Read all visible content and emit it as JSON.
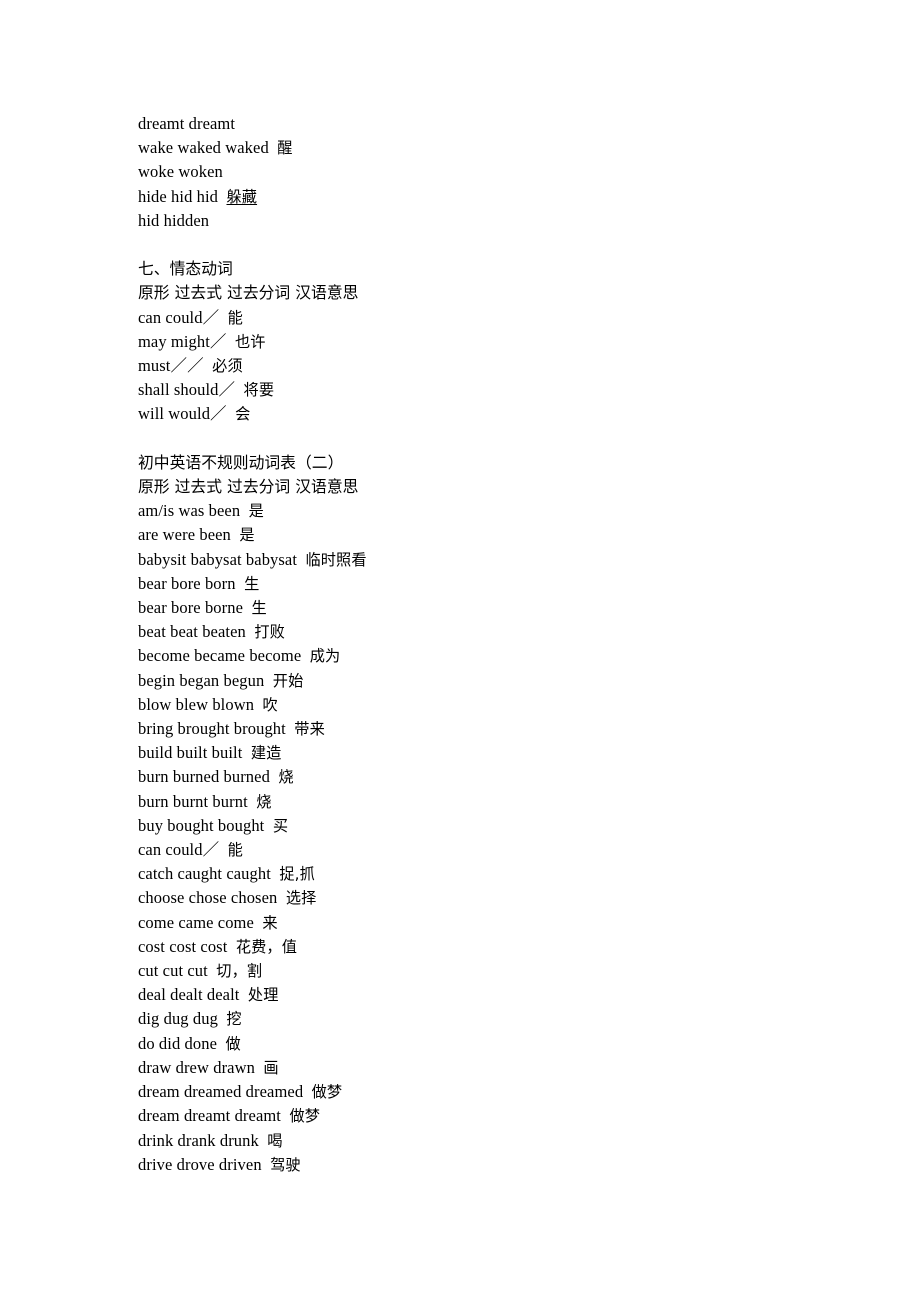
{
  "document": {
    "sections": [
      {
        "id": "continuation-lines",
        "heading": null,
        "column_header": null,
        "lines": [
          {
            "en": "dreamt dreamt",
            "zh": "",
            "zh_underlined": false
          },
          {
            "en": "wake waked waked",
            "zh": "醒",
            "zh_underlined": false
          },
          {
            "en": "woke woken",
            "zh": "",
            "zh_underlined": false
          },
          {
            "en": "hide hid hid",
            "zh": "躲藏",
            "zh_underlined": true
          },
          {
            "en": "hid hidden",
            "zh": "",
            "zh_underlined": false
          }
        ]
      },
      {
        "id": "modal-verbs",
        "heading": {
          "prefix": "七、",
          "title": "情态动词",
          "title_underlined": true,
          "suffix": ""
        },
        "column_header": "原形 过去式 过去分词 汉语意思",
        "lines": [
          {
            "en": "can could／",
            "zh": "能",
            "zh_underlined": false
          },
          {
            "en": "may might／",
            "zh": "也许",
            "zh_underlined": false
          },
          {
            "en": "must／／",
            "zh": "必须",
            "zh_underlined": false
          },
          {
            "en": "shall should／",
            "zh": "将要",
            "zh_underlined": false
          },
          {
            "en": "will would／",
            "zh": "会",
            "zh_underlined": false
          }
        ]
      },
      {
        "id": "irregular-verbs-table-2",
        "heading": {
          "prefix": "",
          "title": "初中英语不规则动词表",
          "title_underlined": true,
          "suffix": "（二）"
        },
        "column_header": "原形 过去式 过去分词 汉语意思",
        "lines": [
          {
            "en": "am/is was been",
            "zh": "是",
            "zh_underlined": false
          },
          {
            "en": "are were been",
            "zh": "是",
            "zh_underlined": false
          },
          {
            "en": "babysit babysat babysat",
            "zh": "临时照看",
            "zh_underlined": false
          },
          {
            "en": "bear bore born",
            "zh": "生",
            "zh_underlined": false
          },
          {
            "en": "bear bore borne",
            "zh": "生",
            "zh_underlined": false
          },
          {
            "en": "beat beat beaten",
            "zh": "打败",
            "zh_underlined": false
          },
          {
            "en": "become became become",
            "zh": "成为",
            "zh_underlined": false
          },
          {
            "en": "begin began begun",
            "zh": "开始",
            "zh_underlined": false
          },
          {
            "en": "blow blew blown",
            "zh": "吹",
            "zh_underlined": false
          },
          {
            "en": "bring brought brought",
            "zh": "带来",
            "zh_underlined": false
          },
          {
            "en": "build built built",
            "zh": "建造",
            "zh_underlined": false
          },
          {
            "en": "burn burned burned",
            "zh": "烧",
            "zh_underlined": false
          },
          {
            "en": "burn burnt burnt",
            "zh": "烧",
            "zh_underlined": false
          },
          {
            "en": "buy bought bought",
            "zh": "买",
            "zh_underlined": false
          },
          {
            "en": "can could／",
            "zh": "能",
            "zh_underlined": false
          },
          {
            "en": "catch caught caught",
            "zh": "捉,抓",
            "zh_underlined": false
          },
          {
            "en": "choose chose chosen",
            "zh": "选择",
            "zh_underlined": false
          },
          {
            "en": "come came come",
            "zh": "来",
            "zh_underlined": false
          },
          {
            "en": "cost cost cost",
            "zh": "花费，值",
            "zh_underlined": false
          },
          {
            "en": "cut cut cut",
            "zh": "切，割",
            "zh_underlined": false
          },
          {
            "en": "deal dealt dealt",
            "zh": "处理",
            "zh_underlined": false
          },
          {
            "en": "dig dug dug",
            "zh": "挖",
            "zh_underlined": false
          },
          {
            "en": "do did done",
            "zh": "做",
            "zh_underlined": false
          },
          {
            "en": "draw drew drawn",
            "zh": "画",
            "zh_underlined": false
          },
          {
            "en": "dream dreamed dreamed",
            "zh": "做梦",
            "zh_underlined": false
          },
          {
            "en": "dream dreamt dreamt",
            "zh": "做梦",
            "zh_underlined": false
          },
          {
            "en": "drink drank drunk",
            "zh": "喝",
            "zh_underlined": false
          },
          {
            "en": "drive drove driven",
            "zh": "驾驶",
            "zh_underlined": false
          }
        ]
      }
    ]
  },
  "colors": {
    "page_background": "#ffffff",
    "text": "#000000"
  }
}
